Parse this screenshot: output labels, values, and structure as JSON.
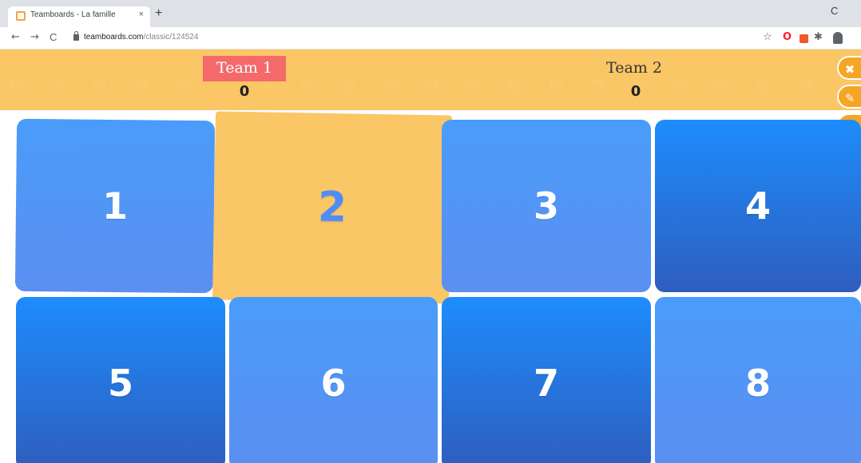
{
  "browser": {
    "tab_title": "Teamboards - La famille",
    "tab_close": "×",
    "new_tab": "+",
    "window_ctrl": "C",
    "back": "←",
    "forward": "→",
    "reload": "C",
    "url_domain": "teamboards.com",
    "url_path": "/classic/124524",
    "star_icon": "☆",
    "ext_opera": "O",
    "ext_puzzle": "✱"
  },
  "game": {
    "team1": {
      "name": "Team 1",
      "score": "0",
      "active": true
    },
    "team2": {
      "name": "Team 2",
      "score": "0",
      "active": false
    },
    "hearts": "♡♡♡♡♡♡♡♡♡♡♡♡♡♡♡♡♡♡♡♡",
    "side_buttons": {
      "close": "✖",
      "edit": "✎",
      "sound": "◀"
    },
    "tiles": [
      {
        "label": "1",
        "state": "hidden"
      },
      {
        "label": "2",
        "state": "flipped"
      },
      {
        "label": "3",
        "state": "hidden"
      },
      {
        "label": "4",
        "state": "hidden"
      },
      {
        "label": "5",
        "state": "hidden"
      },
      {
        "label": "6",
        "state": "hidden"
      },
      {
        "label": "7",
        "state": "hidden"
      },
      {
        "label": "8",
        "state": "hidden"
      }
    ]
  },
  "colors": {
    "header": "#fac666",
    "team_active": "#f46a6a",
    "tile_light": "#4a9cfa",
    "tile_dark": "#2e5ebd",
    "side_button": "#f5a623"
  }
}
